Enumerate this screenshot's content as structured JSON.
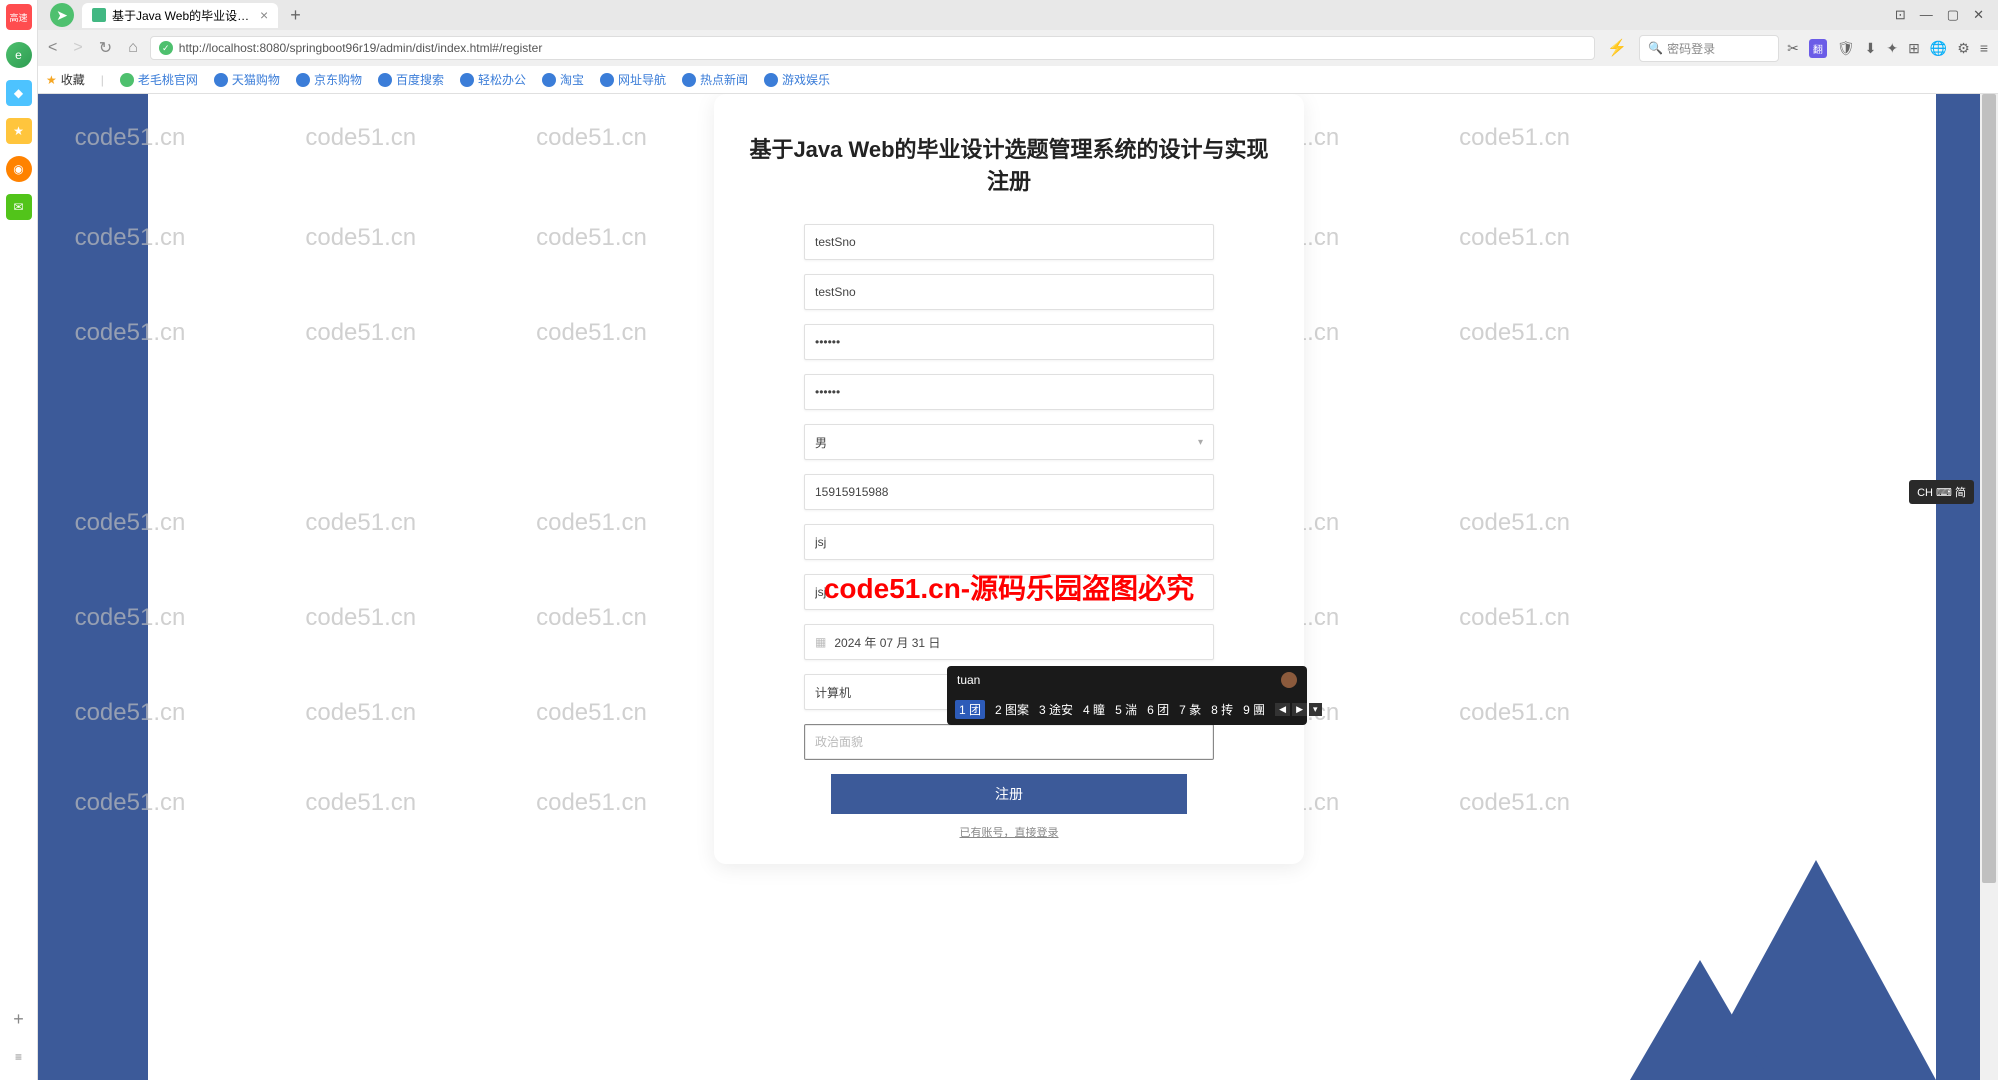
{
  "browser": {
    "tab_title": "基于Java Web的毕业设计选题",
    "url": "http://localhost:8080/springboot96r19/admin/dist/index.html#/register",
    "search_placeholder": "密码登录",
    "translate_label": "翻"
  },
  "bookmarks": {
    "fav_label": "收藏",
    "items": [
      "老毛桃官网",
      "天猫购物",
      "京东购物",
      "百度搜索",
      "轻松办公",
      "淘宝",
      "网址导航",
      "热点新闻",
      "游戏娱乐"
    ]
  },
  "watermark": {
    "text": "code51.cn",
    "red_text": "code51.cn-源码乐园盗图必究"
  },
  "form": {
    "title": "基于Java Web的毕业设计选题管理系统的设计与实现 注册",
    "fields": {
      "sno": "testSno",
      "name": "testSno",
      "password": "••••••",
      "password2": "••••••",
      "gender": "男",
      "phone": "15915915988",
      "major": "jsj",
      "class": "jsj",
      "date": "2024 年 07 月 31 日",
      "dept": "计算机",
      "political_placeholder": "政治面貌"
    },
    "submit_label": "注册",
    "login_text": "已有账号，直接登录"
  },
  "ime": {
    "input": "tuan",
    "candidates": [
      "1 团",
      "2 图案",
      "3 途安",
      "4 瞳",
      "5 湍",
      "6 团",
      "7 彖",
      "8 抟",
      "9 團"
    ],
    "badge": "CH ⌨ 简"
  }
}
